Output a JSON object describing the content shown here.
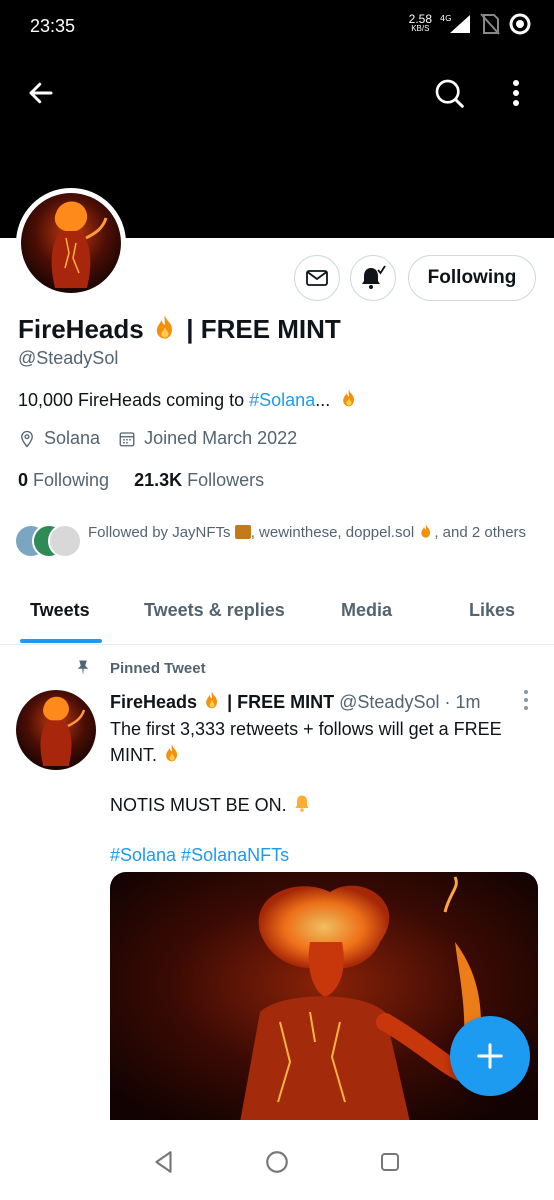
{
  "status_bar": {
    "time": "23:35",
    "speed_value": "2.58",
    "speed_unit": "KB/S",
    "network": "4G"
  },
  "profile": {
    "display_name": "FireHeads",
    "name_suffix": "| FREE MINT",
    "handle": "@SteadySol",
    "bio_text": "10,000 FireHeads coming to ",
    "bio_link": "#Solana",
    "bio_ellipsis": "...",
    "location": "Solana",
    "joined": "Joined March 2022",
    "following_count": "0",
    "following_label": "Following",
    "followers_count": "21.3K",
    "followers_label": "Followers",
    "followed_by_prefix": "Followed by JayNFTs",
    "followed_by_middle": ", wewinthese, doppel.sol",
    "followed_by_suffix": ", and 2 others"
  },
  "actions": {
    "following_button": "Following"
  },
  "tabs": [
    {
      "label": "Tweets",
      "active": true
    },
    {
      "label": "Tweets & replies",
      "active": false
    },
    {
      "label": "Media",
      "active": false
    },
    {
      "label": "Likes",
      "active": false
    }
  ],
  "pinned_tweet": {
    "pinned_label": "Pinned Tweet",
    "author_name": "FireHeads",
    "author_suffix": "| FREE MINT",
    "author_handle": "@SteadySol",
    "separator": "·",
    "time": "1m",
    "line1": "The first 3,333 retweets + follows will get a FREE MINT.",
    "line2": "NOTIS MUST BE ON.",
    "hashtags": "#Solana #SolanaNFTs"
  },
  "icons": {
    "back": "back-arrow-icon",
    "search": "search-icon",
    "more": "more-vertical-icon",
    "message": "message-icon",
    "notifications": "bell-check-icon",
    "location": "location-pin-icon",
    "calendar": "calendar-icon",
    "pin": "pin-icon",
    "compose": "plus-icon",
    "fire_emoji": "fire-emoji",
    "bell_emoji": "bell-emoji"
  },
  "colors": {
    "accent": "#1d9bf0",
    "text": "#0f1419",
    "secondary": "#536471",
    "border": "#cfd9de"
  }
}
